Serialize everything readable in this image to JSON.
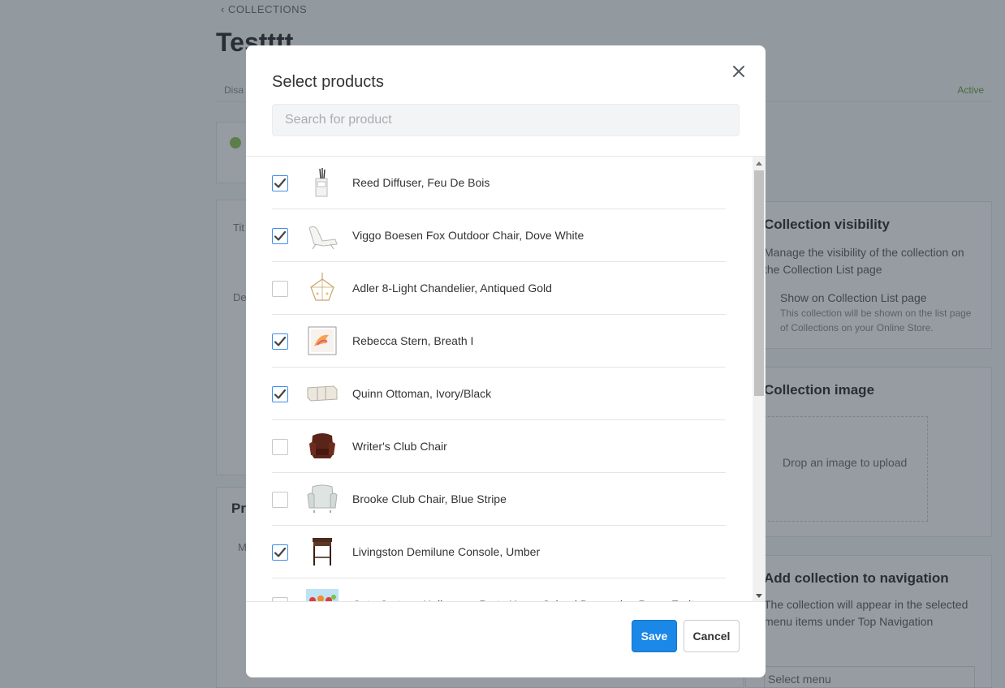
{
  "background": {
    "breadcrumb": "‹ COLLECTIONS",
    "page_title": "Testttt",
    "status_left": "Disa",
    "status_right": "Active",
    "field_title": "Tit",
    "field_desc": "De",
    "products_section": "Pr",
    "products_sub": "M",
    "visibility": {
      "title": "Collection visibility",
      "desc": "Manage the visibility of the collection on the Collection List page",
      "checkbox_label": "Show on Collection List page",
      "checkbox_help": "This collection will be shown on the list page of Collections on your Online Store."
    },
    "image": {
      "title": "Collection image",
      "drop": "Drop an image to upload"
    },
    "navigation": {
      "title": "Add collection to navigation",
      "desc": "The collection will appear in the selected menu items under Top Navigation",
      "select": "Select menu"
    }
  },
  "modal": {
    "title": "Select products",
    "search_placeholder": "Search for product",
    "close_icon": "close-icon",
    "colors": {
      "accent": "#1b87e6",
      "checkbox_border": "#3f8ee8"
    },
    "products": [
      {
        "name": "Reed Diffuser, Feu De Bois",
        "checked": true,
        "icon": "diffuser-thumb"
      },
      {
        "name": "Viggo Boesen Fox Outdoor Chair, Dove White",
        "checked": true,
        "icon": "outdoor-chair-thumb"
      },
      {
        "name": "Adler 8-Light Chandelier, Antiqued Gold",
        "checked": false,
        "icon": "chandelier-thumb"
      },
      {
        "name": "Rebecca Stern, Breath I",
        "checked": true,
        "icon": "artwork-thumb"
      },
      {
        "name": "Quinn Ottoman, Ivory/Black",
        "checked": true,
        "icon": "ottoman-thumb"
      },
      {
        "name": "Writer's Club Chair",
        "checked": false,
        "icon": "leather-chair-thumb"
      },
      {
        "name": "Brooke Club Chair, Blue Stripe",
        "checked": false,
        "icon": "club-chair-thumb"
      },
      {
        "name": "Livingston Demilune Console, Umber",
        "checked": true,
        "icon": "console-thumb"
      },
      {
        "name": "Cute Cartoon Halloween Party Home School Decoration Props Fruit",
        "checked": false,
        "icon": "halloween-props-thumb"
      }
    ],
    "save_label": "Save",
    "cancel_label": "Cancel"
  }
}
